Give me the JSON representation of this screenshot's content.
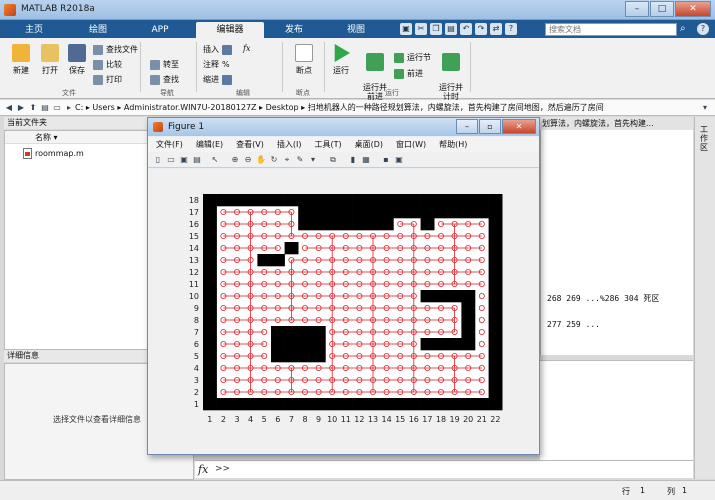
{
  "app": {
    "title": "MATLAB R2018a",
    "window_buttons": {
      "minimize": "–",
      "maximize": "□",
      "close": "✕"
    }
  },
  "tabs": [
    {
      "label": "主页",
      "active": false
    },
    {
      "label": "绘图",
      "active": false
    },
    {
      "label": "APP",
      "active": false
    },
    {
      "label": "编辑器",
      "active": true
    },
    {
      "label": "发布",
      "active": false
    },
    {
      "label": "视图",
      "active": false
    }
  ],
  "search": {
    "placeholder": "搜索文档"
  },
  "ribbon": {
    "file": {
      "new": "新建",
      "open": "打开",
      "save": "保存",
      "find_files": "查找文件",
      "compare": "比较",
      "print": "打印",
      "group": "文件"
    },
    "navigate": {
      "goto": "转至",
      "find": "查找",
      "group": "导航"
    },
    "edit": {
      "insert": "插入",
      "comment": "注释",
      "indent": "缩进",
      "fx": "fx",
      "pct": "%",
      "group": "编辑"
    },
    "breakpoints": {
      "breakpoints": "断点",
      "group": "断点"
    },
    "run": {
      "run": "运行",
      "run_advance": "运行并\n前进",
      "run_section": "运行节",
      "advance": "前进",
      "run_time": "运行并\n计时",
      "group": "运行"
    }
  },
  "path": {
    "segments": "C: ▸ Users ▸ Administrator.WIN7U-20180127Z ▸ Desktop ▸ 扫地机器人的一种路径规划算法，内螺旋法，首先构建了房间地图，然后遍历了房间"
  },
  "current_folder": {
    "header": "当前文件夹",
    "col_name": "名称 ▾",
    "files": [
      "roommap.m"
    ]
  },
  "details": {
    "header": "详细信息",
    "message": "选择文件以查看详细信息"
  },
  "editor": {
    "tab": "划算法，内螺旋法，首先构建...",
    "lines": [
      "268 269  ...%286 304 死区",
      "277 259 ..."
    ]
  },
  "workspace": {
    "label": "工作区"
  },
  "command": {
    "fx": "fx",
    "prompt": ">>"
  },
  "status": {
    "row_label": "行",
    "row": "1",
    "col_label": "列",
    "col": "1"
  },
  "figure": {
    "title": "Figure 1",
    "buttons": {
      "minimize": "–",
      "restore": "▫",
      "close": "✕"
    },
    "menu": [
      "文件(F)",
      "编辑(E)",
      "查看(V)",
      "插入(I)",
      "工具(T)",
      "桌面(D)",
      "窗口(W)",
      "帮助(H)"
    ]
  },
  "chart_data": {
    "type": "heatmap",
    "description_source": "map grid with robot path",
    "x_ticks": [
      1,
      2,
      3,
      4,
      5,
      6,
      7,
      8,
      9,
      10,
      11,
      12,
      13,
      14,
      15,
      16,
      17,
      18,
      19,
      20,
      21,
      22
    ],
    "y_ticks": [
      1,
      2,
      3,
      4,
      5,
      6,
      7,
      8,
      9,
      10,
      11,
      12,
      13,
      14,
      15,
      16,
      17,
      18
    ],
    "xlim": [
      0.5,
      22.5
    ],
    "ylim": [
      0.5,
      18.5
    ],
    "free_color": "#ffffff",
    "wall_color": "#000000",
    "path_color": "#e0222a",
    "grid_rows_top_to_bottom": [
      "1111111111111111111111",
      "1000000111111111111111",
      "1000000111111100100001",
      "1000000000000000000001",
      "1000001000000000000001",
      "1000110000000000000001",
      "1000000000000000000001",
      "1000000000000000000001",
      "1000000000000000111101",
      "1000000000000000000101",
      "1000000000000000000101",
      "1000011110000000000101",
      "1000011110000000111101",
      "1000011110000000000001",
      "1000000000000000000001",
      "1000000000000000000001",
      "1000000000000000000001",
      "1111111111111111111111"
    ]
  }
}
